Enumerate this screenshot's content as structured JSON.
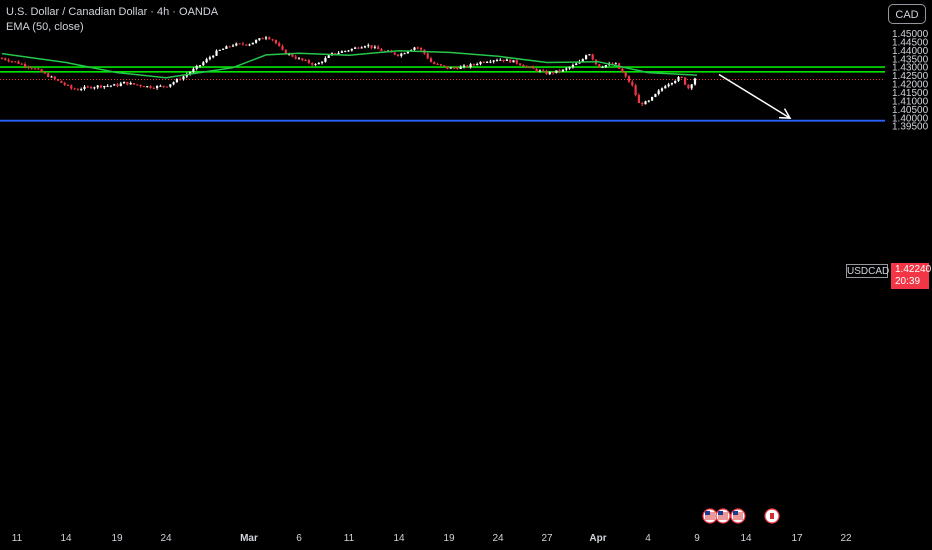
{
  "header": {
    "title": "U.S. Dollar / Canadian Dollar · 4h · OANDA",
    "indicator": "EMA (50, close)"
  },
  "price_axis": {
    "currency": "CAD",
    "ticks": [
      "1.45000",
      "1.44500",
      "1.44000",
      "1.43500",
      "1.43000",
      "1.42500",
      "1.42000",
      "1.41500",
      "1.41000",
      "1.40500",
      "1.40000",
      "1.39500"
    ]
  },
  "time_axis": {
    "labels": [
      "11",
      "14",
      "19",
      "24",
      "Mar",
      "6",
      "11",
      "14",
      "19",
      "24",
      "27",
      "Apr",
      "4",
      "9",
      "14",
      "17",
      "22"
    ],
    "bold_labels": [
      "Mar",
      "Apr"
    ]
  },
  "last_price": {
    "symbol": "USDCAD",
    "price": "1.42240",
    "countdown": "20:39"
  },
  "colors": {
    "background": "#000000",
    "up_candle": "#ffffff",
    "down_candle": "#f23645",
    "ema": "#26c64b",
    "level_line": "#00e600",
    "support_line": "#2962ff",
    "last_price_line": "#f23645",
    "arrow": "#ffffff"
  },
  "event_icons": [
    "us-flag-icon",
    "us-flag-icon",
    "us-flag-icon",
    "ca-flag-icon"
  ],
  "chart_data": {
    "type": "candlestick",
    "series": [
      {
        "name": "USDCAD",
        "type": "candlestick"
      },
      {
        "name": "EMA (50, close)",
        "type": "line"
      }
    ],
    "ylim": [
      1.393,
      1.4515
    ],
    "x_dates": [
      "Feb 11",
      "Feb 14",
      "Feb 19",
      "Feb 24",
      "Mar 3",
      "Mar 6",
      "Mar 11",
      "Mar 14",
      "Mar 19",
      "Mar 24",
      "Mar 27",
      "Apr 1",
      "Apr 4",
      "Apr 9",
      "Apr 14",
      "Apr 17",
      "Apr 22"
    ],
    "anchors_close": [
      [
        "Feb 10",
        1.435
      ],
      [
        "Feb 11",
        1.4325
      ],
      [
        "Feb 12",
        1.429
      ],
      [
        "Feb 13",
        1.424
      ],
      [
        "Feb 14",
        1.419
      ],
      [
        "Feb 14",
        1.4165
      ],
      [
        "Feb 18",
        1.4185
      ],
      [
        "Feb 19",
        1.419
      ],
      [
        "Feb 19",
        1.4205
      ],
      [
        "Feb 20",
        1.4195
      ],
      [
        "Feb 21",
        1.418
      ],
      [
        "Feb 24",
        1.4185
      ],
      [
        "Feb 25",
        1.424
      ],
      [
        "Feb 26",
        1.431
      ],
      [
        "Feb 27",
        1.439
      ],
      [
        "Feb 28",
        1.443
      ],
      [
        "Mar 3",
        1.4435
      ],
      [
        "Mar 4",
        1.448
      ],
      [
        "Mar 4",
        1.446
      ],
      [
        "Mar 5",
        1.439
      ],
      [
        "Mar 6",
        1.4345
      ],
      [
        "Mar 7",
        1.431
      ],
      [
        "Mar 10",
        1.4375
      ],
      [
        "Mar 11",
        1.44
      ],
      [
        "Mar 12",
        1.443
      ],
      [
        "Mar 13",
        1.4395
      ],
      [
        "Mar 14",
        1.437
      ],
      [
        "Mar 17",
        1.442
      ],
      [
        "Mar 17",
        1.439
      ],
      [
        "Mar 18",
        1.432
      ],
      [
        "Mar 19",
        1.429
      ],
      [
        "Mar 20",
        1.43
      ],
      [
        "Mar 21",
        1.433
      ],
      [
        "Mar 24",
        1.4345
      ],
      [
        "Mar 25",
        1.433
      ],
      [
        "Mar 26",
        1.429
      ],
      [
        "Mar 27",
        1.426
      ],
      [
        "Mar 28",
        1.428
      ],
      [
        "Mar 31",
        1.433
      ],
      [
        "Mar 31",
        1.439
      ],
      [
        "Apr 1",
        1.43
      ],
      [
        "Apr 2",
        1.432
      ],
      [
        "Apr 3",
        1.419
      ],
      [
        "Apr 3",
        1.408
      ],
      [
        "Apr 4",
        1.409
      ],
      [
        "Apr 7",
        1.419
      ],
      [
        "Apr 8",
        1.424
      ],
      [
        "Apr 8",
        1.417
      ],
      [
        "Apr 9",
        1.425
      ],
      [
        "Apr 9",
        1.4224
      ]
    ],
    "ema_anchors": [
      [
        "Feb 10",
        1.4378
      ],
      [
        "Feb 14",
        1.4325
      ],
      [
        "Feb 19",
        1.4265
      ],
      [
        "Feb 24",
        1.4235
      ],
      [
        "Feb 28",
        1.4295
      ],
      [
        "Mar 4",
        1.437
      ],
      [
        "Mar 6",
        1.438
      ],
      [
        "Mar 11",
        1.4368
      ],
      [
        "Mar 14",
        1.4395
      ],
      [
        "Mar 19",
        1.4385
      ],
      [
        "Mar 24",
        1.4362
      ],
      [
        "Mar 27",
        1.4325
      ],
      [
        "Apr 1",
        1.433
      ],
      [
        "Apr 4",
        1.4265
      ],
      [
        "Apr 9",
        1.425
      ]
    ],
    "horizontal_levels": [
      1.4298,
      1.427,
      1.398
    ],
    "last_price_level": 1.4224,
    "arrow": {
      "from": [
        "Apr 10",
        1.4254
      ],
      "to": [
        "Apr 16",
        1.3995
      ]
    }
  }
}
